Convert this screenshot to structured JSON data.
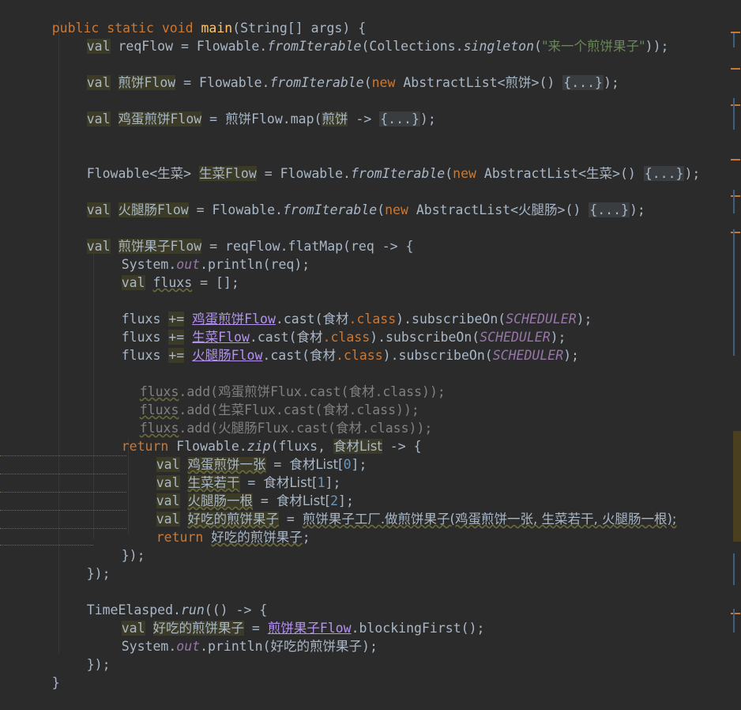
{
  "colors": {
    "background": "#2b2b2b",
    "keyword": "#cc7832",
    "text": "#a9b7c6",
    "method": "#ffc66d",
    "string": "#6a8759",
    "static_field": "#9876aa",
    "number": "#6897bb",
    "comment_grey": "#808080"
  },
  "code": {
    "l01": {
      "a": "public static void ",
      "b": "main",
      "c": "(String[] args) {"
    },
    "l02": {
      "a": "val",
      "b": " reqFlow = Flowable.",
      "c": "fromIterable",
      "d": "(Collections.",
      "e": "singleton",
      "f": "(",
      "g": "\"来一个煎饼果子\"",
      "h": "));"
    },
    "l04": {
      "a": "val",
      "b": " ",
      "c": "煎饼",
      "d": "Flow",
      "e": " = Flowable.",
      "f": "fromIterable",
      "g": "(",
      "h": "new",
      "i": " AbstractList<",
      "j": "煎饼",
      "k": ">() ",
      "l": "{...}",
      "m": ");"
    },
    "l06": {
      "a": "val",
      "b": " ",
      "c": "鸡蛋煎饼",
      "d": "Flow",
      "e": " = ",
      "f": "煎饼",
      "g": "Flow.map(",
      "h": "煎饼",
      "i": " -> ",
      "j": "{...}",
      "k": ");"
    },
    "l09": {
      "a": "Flowable<",
      "b": "生菜",
      "c": "> ",
      "d": "生菜",
      "e": "Flow",
      "f": " = Flowable.",
      "g": "fromIterable",
      "h": "(",
      "i": "new",
      "j": " AbstractList<",
      "k": "生菜",
      "l": ">() ",
      "m": "{...}",
      "n": ");"
    },
    "l11": {
      "a": "val",
      "b": " ",
      "c": "火腿肠",
      "d": "Flow",
      "e": " = Flowable.",
      "f": "fromIterable",
      "g": "(",
      "h": "new",
      "i": " AbstractList<",
      "j": "火腿肠",
      "k": ">() ",
      "l": "{...}",
      "m": ");"
    },
    "l13": {
      "a": "val",
      "b": " ",
      "c": "煎饼果子",
      "d": "Flow",
      "e": " = reqFlow.flatMap(req -> {"
    },
    "l14": {
      "a": "System.",
      "b": "out",
      "c": ".println(req);"
    },
    "l15": {
      "a": "val",
      "b": " ",
      "c": "fluxs",
      "d": " = [];"
    },
    "l17": {
      "a": "fluxs ",
      "b": "+=",
      "c": " ",
      "d": "鸡蛋煎饼",
      "e": "Flow",
      ".f": "",
      "f": ".cast(",
      "g": "食材",
      ".h": "",
      "h": ".class",
      "i": ").subscribeOn(",
      "j": "SCHEDULER",
      "k": ");"
    },
    "l18": {
      "a": "fluxs ",
      "b": "+=",
      "c": " ",
      "d": "生菜",
      "e": "Flow",
      "f": ".cast(",
      "g": "食材",
      "h": ".class",
      "i": ").subscribeOn(",
      "j": "SCHEDULER",
      "k": ");"
    },
    "l19": {
      "a": "fluxs ",
      "b": "+=",
      "c": " ",
      "d": "火腿肠",
      "e": "Flow",
      "f": ".cast(",
      "g": "食材",
      "h": ".class",
      "i": ").subscribeOn(",
      "j": "SCHEDULER",
      "k": ");"
    },
    "l21": {
      "a": "fluxs",
      "b": ".add(",
      "c": "鸡蛋煎饼",
      "d": "Flux.cast(",
      "e": "食材",
      "f": ".class));"
    },
    "l22": {
      "a": "fluxs",
      "b": ".add(",
      "c": "生菜",
      "d": "Flux.cast(",
      "e": "食材",
      "f": ".class));"
    },
    "l23": {
      "a": "fluxs",
      "b": ".add(",
      "c": "火腿肠",
      "d": "Flux.cast(",
      "e": "食材",
      "f": ".class));"
    },
    "l24": {
      "a": "return",
      "b": " Flowable.",
      "c": "zip",
      "d": "(fluxs, ",
      "e": "食材List",
      "f": " -> {"
    },
    "l25": {
      "a": "val",
      "b": " ",
      "c": "鸡蛋煎饼一张",
      "d": " = ",
      "e": "食材List[",
      "f": "0",
      "g": "];"
    },
    "l26": {
      "a": "val",
      "b": " ",
      "c": "生菜若干",
      "d": " = ",
      "e": "食材List[",
      "f": "1",
      "g": "];"
    },
    "l27": {
      "a": "val",
      "b": " ",
      "c": "火腿肠一根",
      "d": " = ",
      "e": "食材List[",
      "f": "2",
      "g": "];"
    },
    "l28": {
      "a": "val",
      "b": " ",
      "c": "好吃的煎饼果子",
      "d": " = ",
      "e": "煎饼果子工厂.做煎饼果子(鸡蛋煎饼一张, 生菜若干, 火腿肠一根);"
    },
    "l29": {
      "a": "return",
      "b": " ",
      "c": "好吃的煎饼果子",
      "d": ";"
    },
    "l30": {
      "a": "});"
    },
    "l31": {
      "a": "});"
    },
    "l33": {
      "a": "TimeElasped.",
      "b": "run",
      "c": "(() -> {"
    },
    "l34": {
      "a": "val",
      "b": " ",
      "c": "好吃的煎饼果子",
      "d": " = ",
      "e": "煎饼果子",
      "f": "Flow",
      "g": ".blockingFirst();"
    },
    "l35": {
      "a": "System.",
      "b": "out",
      "c": ".println(",
      "d": "好吃的煎饼果子",
      "e": ");"
    },
    "l36": {
      "a": "});"
    },
    "l37": {
      "a": "}"
    }
  }
}
